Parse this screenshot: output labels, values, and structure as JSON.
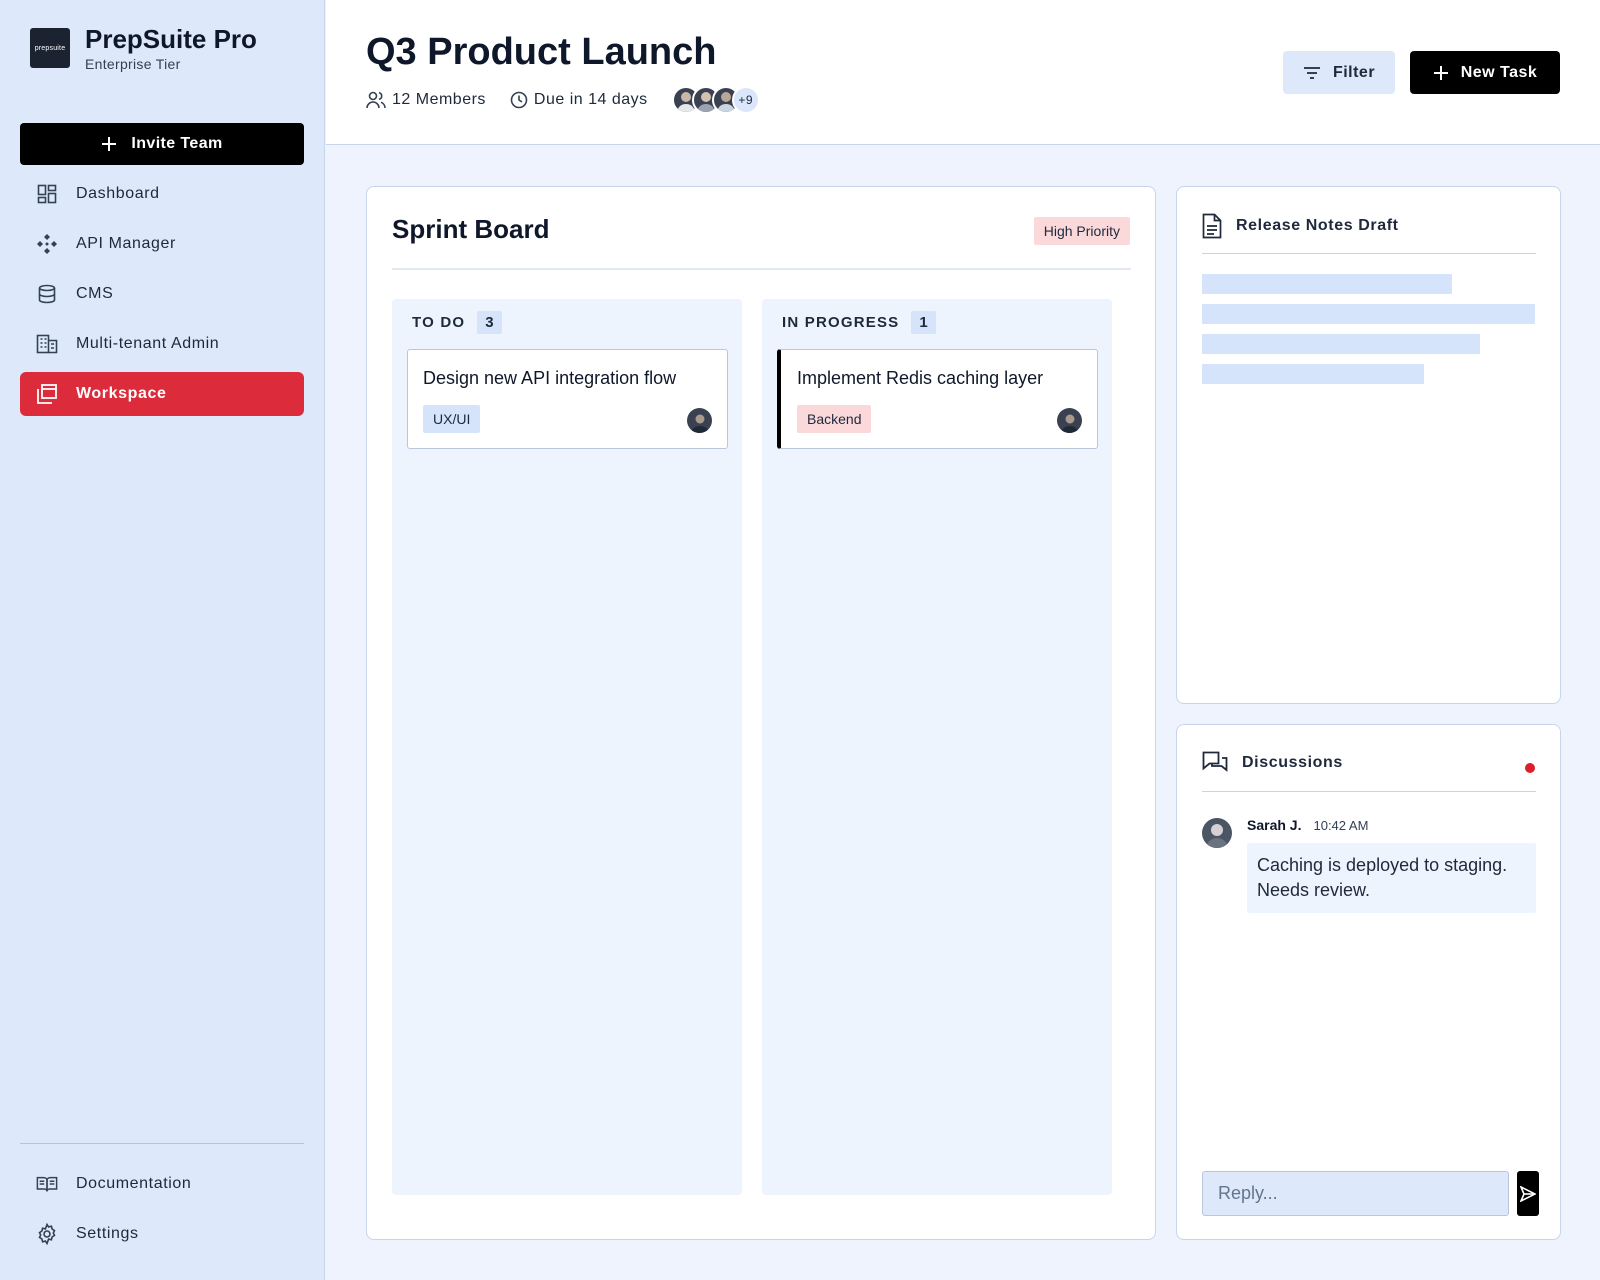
{
  "brand": {
    "logo_text": "prepsuite",
    "name": "PrepSuite Pro",
    "tier": "Enterprise Tier"
  },
  "sidebar": {
    "invite_label": "Invite Team",
    "items": [
      {
        "label": "Dashboard",
        "icon": "dashboard-icon"
      },
      {
        "label": "API Manager",
        "icon": "api-icon"
      },
      {
        "label": "CMS",
        "icon": "database-icon"
      },
      {
        "label": "Multi-tenant Admin",
        "icon": "building-icon"
      },
      {
        "label": "Workspace",
        "icon": "workspace-icon",
        "active": true
      }
    ],
    "bottom_items": [
      {
        "label": "Documentation",
        "icon": "book-icon"
      },
      {
        "label": "Settings",
        "icon": "gear-icon"
      }
    ]
  },
  "header": {
    "title": "Q3 Product Launch",
    "members": "12 Members",
    "due": "Due in 14 days",
    "avatar_more": "+9",
    "filter_label": "Filter",
    "new_task_label": "New Task"
  },
  "board": {
    "title": "Sprint Board",
    "priority": "High Priority",
    "columns": [
      {
        "name": "TO DO",
        "count": "3",
        "cards": [
          {
            "title": "Design new API integration flow",
            "tag": "UX/UI"
          }
        ]
      },
      {
        "name": "IN PROGRESS",
        "count": "1",
        "cards": [
          {
            "title": "Implement Redis caching layer",
            "tag": "Backend"
          }
        ]
      }
    ]
  },
  "notes": {
    "title": "Release Notes Draft"
  },
  "discussions": {
    "title": "Discussions",
    "messages": [
      {
        "author": "Sarah J.",
        "time": "10:42 AM",
        "text": "Caching is deployed to staging. Needs review."
      }
    ],
    "reply_placeholder": "Reply..."
  },
  "colors": {
    "accent": "#dc2b3a",
    "primary": "#000000",
    "sidebar_bg": "#dde8fb",
    "unread_dot": "#dc1f2b"
  }
}
